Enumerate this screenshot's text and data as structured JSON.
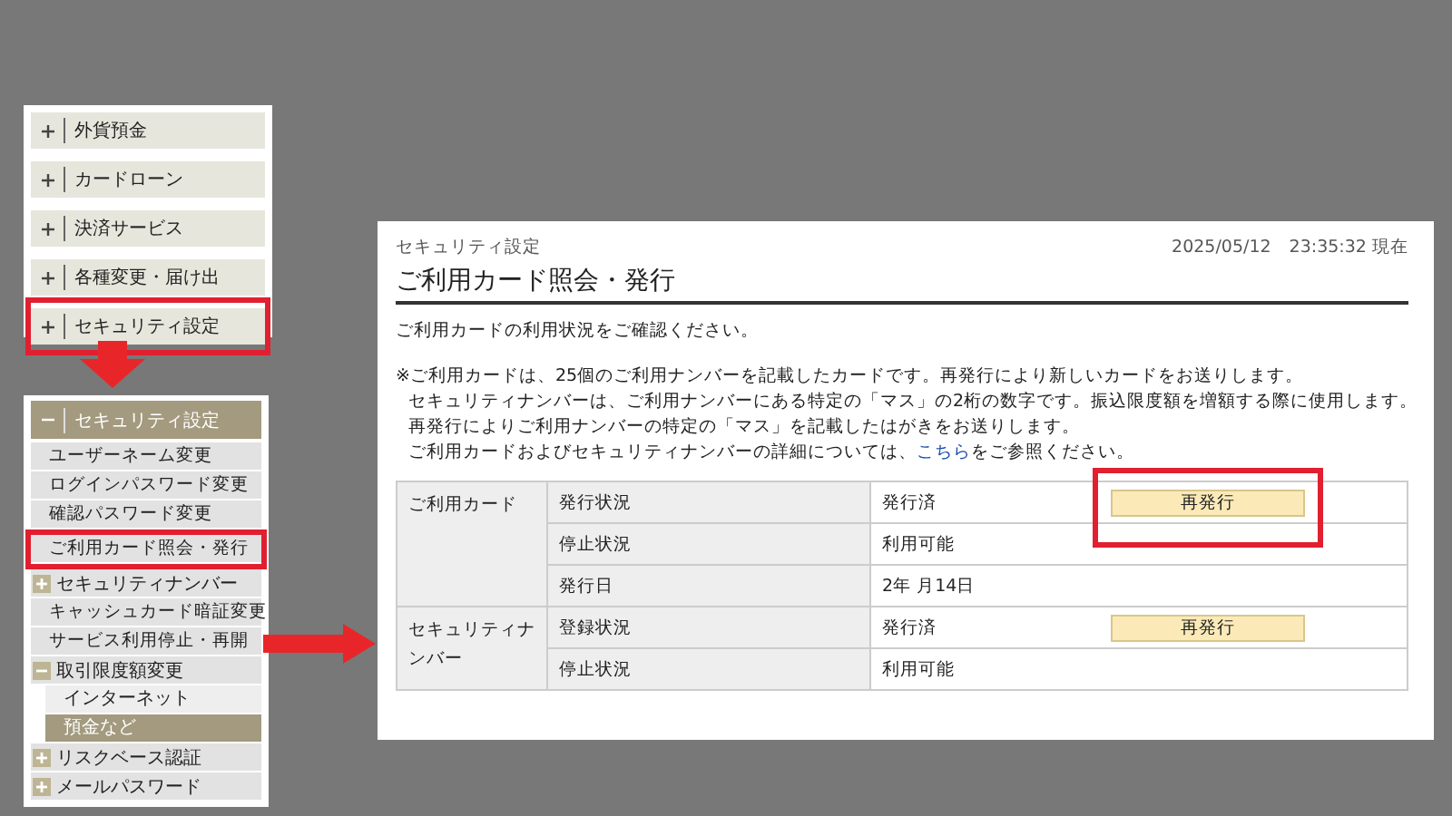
{
  "top_menu": {
    "items": [
      {
        "label": "外貨預金",
        "expanded": false,
        "highlighted": false
      },
      {
        "label": "カードローン",
        "expanded": false,
        "highlighted": false
      },
      {
        "label": "決済サービス",
        "expanded": false,
        "highlighted": false
      },
      {
        "label": "各種変更・届け出",
        "expanded": false,
        "highlighted": false
      },
      {
        "label": "セキュリティ設定",
        "expanded": false,
        "highlighted": true
      }
    ]
  },
  "side_menu": {
    "title": "セキュリティ設定",
    "expanded": true,
    "items": [
      {
        "kind": "link",
        "label": "ユーザーネーム変更",
        "highlighted": false
      },
      {
        "kind": "link",
        "label": "ログインパスワード変更",
        "highlighted": false
      },
      {
        "kind": "link",
        "label": "確認パスワード変更",
        "highlighted": false
      },
      {
        "kind": "link",
        "label": "ご利用カード照会・発行",
        "highlighted": true
      },
      {
        "kind": "group",
        "label": "セキュリティナンバー",
        "expanded": false
      },
      {
        "kind": "link",
        "label": "キャッシュカード暗証変更",
        "highlighted": false
      },
      {
        "kind": "link",
        "label": "サービス利用停止・再開",
        "highlighted": false
      },
      {
        "kind": "group",
        "label": "取引限度額変更",
        "expanded": true,
        "children": [
          {
            "label": "インターネット",
            "selected": false
          },
          {
            "label": "預金など",
            "selected": true
          }
        ]
      },
      {
        "kind": "group",
        "label": "リスクベース認証",
        "expanded": false
      },
      {
        "kind": "group",
        "label": "メールパスワード",
        "expanded": false
      }
    ]
  },
  "main": {
    "breadcrumb": "セキュリティ設定",
    "timestamp": "2025/05/12　23:35:32 現在",
    "title": "ご利用カード照会・発行",
    "intro": "ご利用カードの利用状況をご確認ください。",
    "notes": [
      "※ご利用カードは、25個のご利用ナンバーを記載したカードです。再発行により新しいカードをお送りします。",
      "セキュリティナンバーは、ご利用ナンバーにある特定の「マス」の2桁の数字です。振込限度額を増額する際に使用します。",
      "再発行によりご利用ナンバーの特定の「マス」を記載したはがきをお送りします。"
    ],
    "link_note": {
      "before": "ご利用カードおよびセキュリティナンバーの詳細については、",
      "link": "こちら",
      "after": "をご参照ください。"
    },
    "table": {
      "groups": [
        {
          "label": "ご利用カード",
          "rows": [
            {
              "field": "発行状況",
              "value": "発行済",
              "button": "再発行",
              "highlighted": true
            },
            {
              "field": "停止状況",
              "value": "利用可能"
            },
            {
              "field": "発行日",
              "value": "2年 月14日"
            }
          ]
        },
        {
          "label": "セキュリティナンバー",
          "rows": [
            {
              "field": "登録状況",
              "value": "発行済",
              "button": "再発行",
              "highlighted": false
            },
            {
              "field": "停止状況",
              "value": "利用可能"
            }
          ]
        }
      ]
    }
  }
}
